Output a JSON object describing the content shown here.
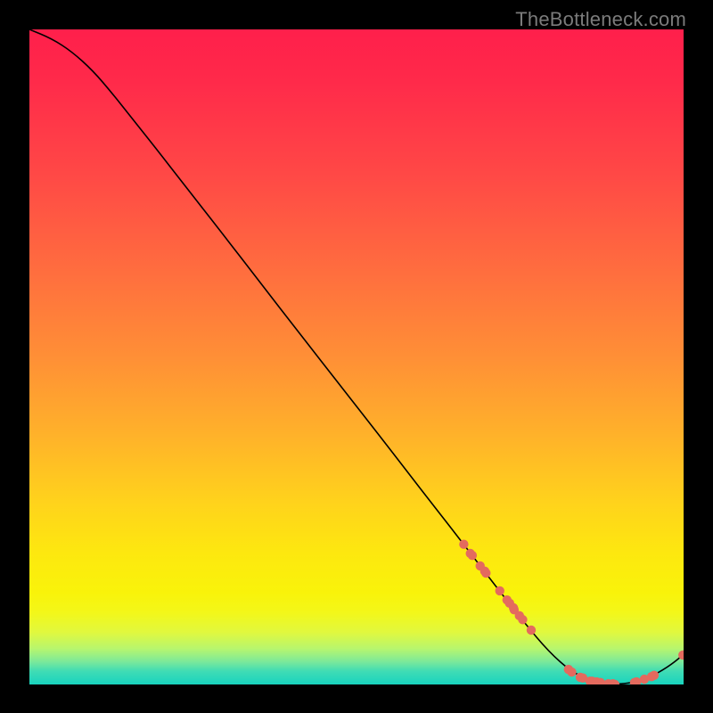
{
  "watermark": "TheBottleneck.com",
  "chart_data": {
    "type": "line",
    "title": "",
    "xlabel": "",
    "ylabel": "",
    "xlim": [
      0,
      100
    ],
    "ylim": [
      0,
      100
    ],
    "grid": false,
    "note": "Axes are unlabeled; coordinates are normalized 0–100 from plot-area pixel positions. y uses math convention (0 at bottom).",
    "series": [
      {
        "name": "curve",
        "style": "black-line",
        "points": [
          {
            "x": 0.0,
            "y": 100.0
          },
          {
            "x": 3.4,
            "y": 98.6
          },
          {
            "x": 6.5,
            "y": 96.6
          },
          {
            "x": 9.7,
            "y": 93.7
          },
          {
            "x": 12.7,
            "y": 90.2
          },
          {
            "x": 15.7,
            "y": 86.4
          },
          {
            "x": 19.3,
            "y": 81.9
          },
          {
            "x": 23.8,
            "y": 76.1
          },
          {
            "x": 29.3,
            "y": 69.1
          },
          {
            "x": 35.4,
            "y": 61.2
          },
          {
            "x": 41.6,
            "y": 53.2
          },
          {
            "x": 47.7,
            "y": 45.4
          },
          {
            "x": 53.9,
            "y": 37.5
          },
          {
            "x": 59.9,
            "y": 29.7
          },
          {
            "x": 65.7,
            "y": 22.3
          },
          {
            "x": 70.9,
            "y": 15.5
          },
          {
            "x": 75.6,
            "y": 9.5
          },
          {
            "x": 79.4,
            "y": 5.0
          },
          {
            "x": 82.9,
            "y": 1.9
          },
          {
            "x": 86.2,
            "y": 0.4
          },
          {
            "x": 89.4,
            "y": 0.0
          },
          {
            "x": 92.5,
            "y": 0.3
          },
          {
            "x": 95.5,
            "y": 1.4
          },
          {
            "x": 98.2,
            "y": 3.1
          },
          {
            "x": 100.0,
            "y": 4.6
          }
        ]
      },
      {
        "name": "highlighted-points",
        "style": "salmon-dot",
        "points": [
          {
            "x": 66.4,
            "y": 21.4
          },
          {
            "x": 67.4,
            "y": 20.0
          },
          {
            "x": 67.7,
            "y": 19.7
          },
          {
            "x": 68.9,
            "y": 18.1
          },
          {
            "x": 69.6,
            "y": 17.3
          },
          {
            "x": 69.8,
            "y": 17.0
          },
          {
            "x": 71.9,
            "y": 14.3
          },
          {
            "x": 73.0,
            "y": 12.9
          },
          {
            "x": 73.4,
            "y": 12.4
          },
          {
            "x": 74.0,
            "y": 11.7
          },
          {
            "x": 74.1,
            "y": 11.4
          },
          {
            "x": 74.9,
            "y": 10.5
          },
          {
            "x": 75.4,
            "y": 9.9
          },
          {
            "x": 76.7,
            "y": 8.3
          },
          {
            "x": 82.4,
            "y": 2.3
          },
          {
            "x": 82.9,
            "y": 1.9
          },
          {
            "x": 84.2,
            "y": 1.1
          },
          {
            "x": 84.6,
            "y": 1.0
          },
          {
            "x": 85.7,
            "y": 0.5
          },
          {
            "x": 86.0,
            "y": 0.5
          },
          {
            "x": 86.7,
            "y": 0.4
          },
          {
            "x": 87.3,
            "y": 0.3
          },
          {
            "x": 88.5,
            "y": 0.1
          },
          {
            "x": 89.2,
            "y": 0.1
          },
          {
            "x": 89.5,
            "y": 0.0
          },
          {
            "x": 92.5,
            "y": 0.3
          },
          {
            "x": 92.8,
            "y": 0.4
          },
          {
            "x": 94.0,
            "y": 0.8
          },
          {
            "x": 95.1,
            "y": 1.2
          },
          {
            "x": 95.5,
            "y": 1.4
          },
          {
            "x": 99.9,
            "y": 4.5
          }
        ]
      }
    ],
    "colors": {
      "line": "#000000",
      "dot": "#e46a5e",
      "gradient_top": "#ff1f4b",
      "gradient_bottom": "#18d3be"
    }
  }
}
